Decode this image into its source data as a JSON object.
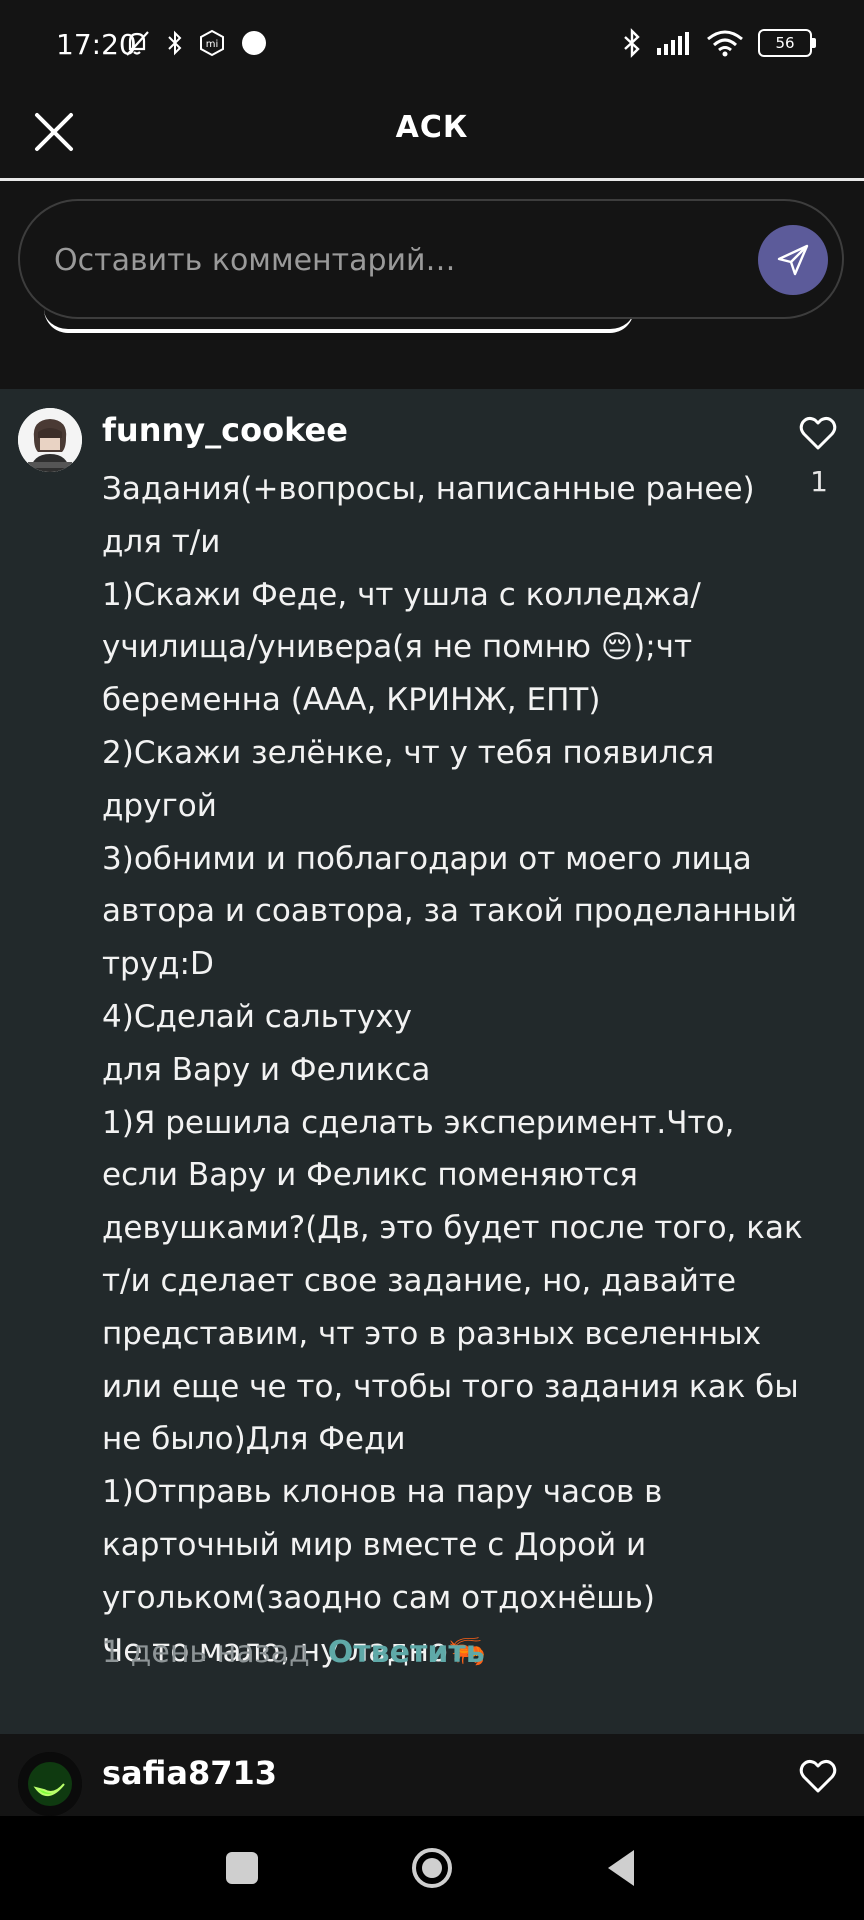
{
  "status_bar": {
    "time": "17:20",
    "battery": "56",
    "icons": [
      "mute-bell-icon",
      "bluetooth-icon",
      "mi-icon",
      "dot-icon",
      "bluetooth-icon",
      "signal-icon",
      "wifi-icon",
      "battery-icon"
    ]
  },
  "header": {
    "title": "АСК",
    "close_icon": "close-icon"
  },
  "comment_box": {
    "placeholder": "Оставить комментарий…",
    "send_icon": "send-icon",
    "send_color": "#5c5b9a"
  },
  "comment": {
    "username": "funny_cookee",
    "likes": "1",
    "lines": [
      "Задания(+вопросы, написанные ранее)",
      "для т/и",
      "1)Скажи Феде, чт ушла с колледжа/",
      "училища/универа(я не помню 😔);чт",
      "беременна (ААА, КРИНЖ, ЕПТ)",
      "2)Скажи зелёнке, чт у тебя появился",
      "другой",
      "3)обними и поблагодари от моего лица",
      "автора и соавтора, за такой проделанный",
      "труд:D",
      "4)Сделай сальтуху",
      "для Вару и Феликса",
      "1)Я решила сделать эксперимент.Что,",
      "если Вару и Феликс поменяются",
      "девушками?(Дв, это будет после того, как",
      "т/и сделает свое задание, но, давайте",
      "представим, чт это в разных вселенных",
      "или еще че то, чтобы того задания как бы",
      "не было)Для Феди",
      "1)Отправь клонов на пару часов в",
      "карточный мир вместе с Дорой и",
      "угольком(заодно сам отдохнёшь)",
      "Че то мало, ну ладно🦐"
    ],
    "time": "1 день назад",
    "reply_label": "Ответить",
    "reply_color": "#5fa9a8"
  },
  "next_comment": {
    "username": "safia8713"
  },
  "colors": {
    "background": "#141414",
    "comment_bg": "#22292b"
  }
}
